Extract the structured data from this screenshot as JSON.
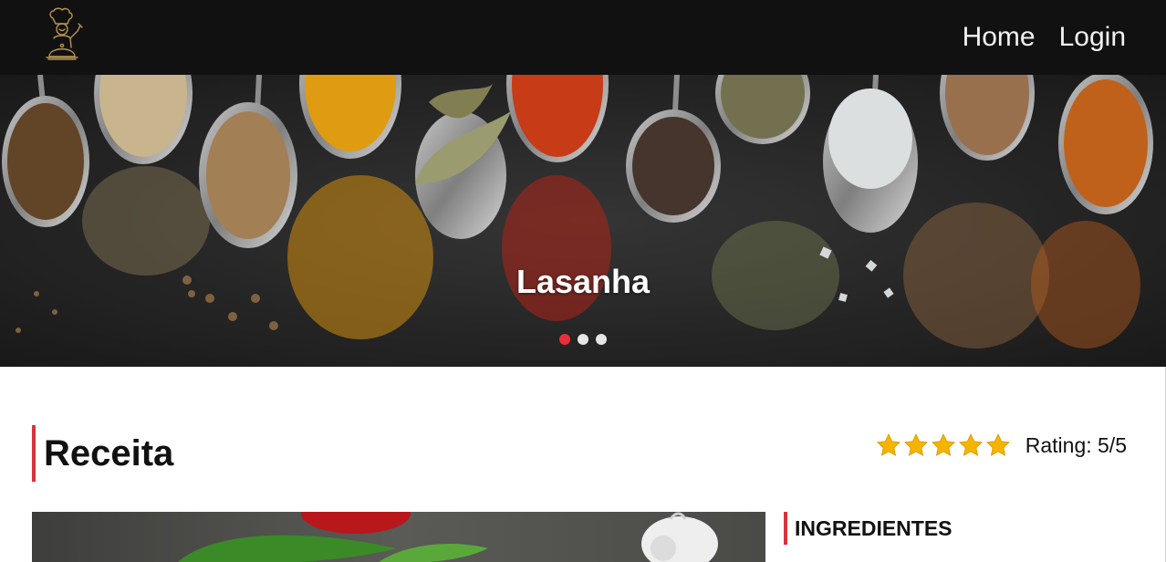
{
  "nav": {
    "logo_icon": "chef-logo-icon",
    "links": [
      {
        "label": "Home"
      },
      {
        "label": "Login"
      }
    ]
  },
  "hero": {
    "caption": "Lasanha",
    "slide_count": 3,
    "active_slide": 1
  },
  "recipe": {
    "section_title": "Receita",
    "rating_value": 5,
    "rating_max": 5,
    "rating_text": "Rating: 5/5",
    "ingredients_title": "INGREDIENTES"
  },
  "colors": {
    "navbar_bg": "#111111",
    "accent_red": "#d9333f",
    "active_dot": "#e8303a",
    "star_gold": "#f5b400"
  }
}
